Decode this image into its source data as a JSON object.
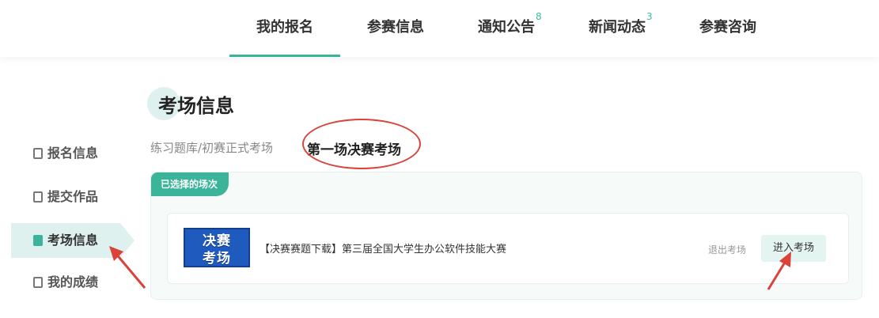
{
  "nav": {
    "items": [
      {
        "label": "我的报名",
        "active": true
      },
      {
        "label": "参赛信息"
      },
      {
        "label": "通知公告",
        "badge": "8"
      },
      {
        "label": "新闻动态",
        "badge": "3"
      },
      {
        "label": "参赛咨询"
      }
    ]
  },
  "sidebar": {
    "items": [
      {
        "label": "报名信息",
        "icon": "edit-icon"
      },
      {
        "label": "提交作品",
        "icon": "document-icon"
      },
      {
        "label": "考场信息",
        "icon": "exam-room-icon",
        "active": true
      },
      {
        "label": "我的成绩",
        "icon": "score-icon"
      }
    ]
  },
  "page": {
    "title": "考场信息"
  },
  "tabs": [
    {
      "label": "练习题库/初赛正式考场"
    },
    {
      "label": "第一场决赛考场",
      "active": true
    }
  ],
  "panel": {
    "tag": "已选择的场次",
    "session": {
      "thumb_line1": "决赛",
      "thumb_line2": "考场",
      "title": "【决赛赛题下载】第三届全国大学生办公软件技能大赛",
      "exit_label": "退出考场",
      "enter_label": "进入考场"
    }
  },
  "colors": {
    "accent": "#3bb49a",
    "annotation": "#d9433a"
  }
}
